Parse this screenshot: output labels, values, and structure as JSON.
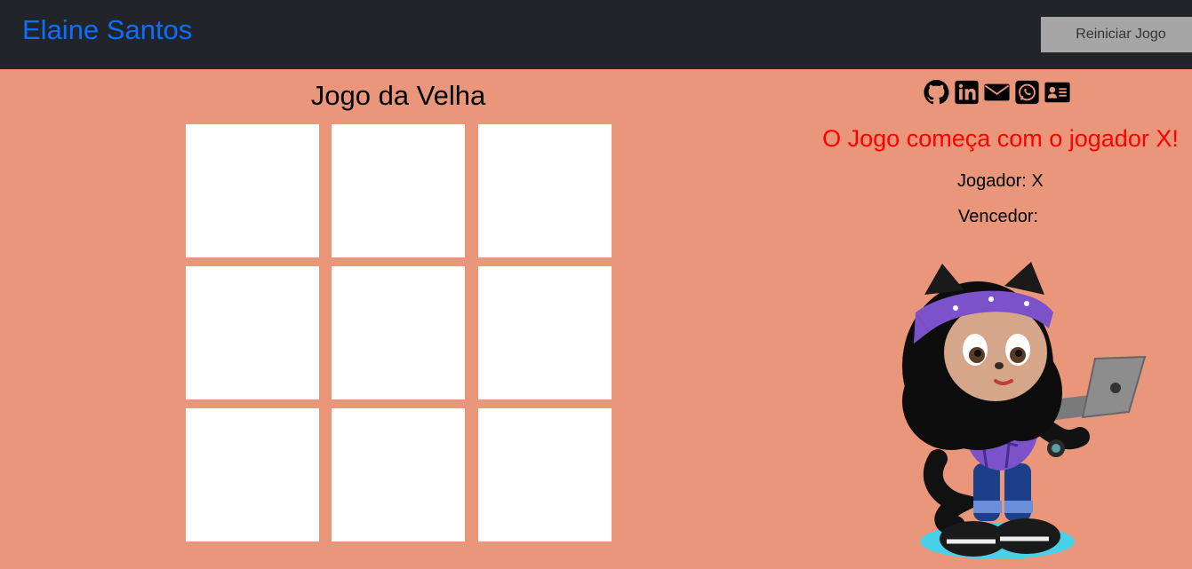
{
  "header": {
    "brand": "Elaine Santos",
    "restart_label": "Reiniciar Jogo"
  },
  "board": {
    "title": "Jogo da Velha",
    "cells": [
      "",
      "",
      "",
      "",
      "",
      "",
      "",
      "",
      ""
    ]
  },
  "social": {
    "icons": [
      "github-icon",
      "linkedin-icon",
      "envelope-icon",
      "whatsapp-icon",
      "contact-card-icon"
    ]
  },
  "status": {
    "start_message": "O Jogo começa com o jogador X!",
    "player_label": "Jogador: X",
    "winner_label": "Vencedor:"
  },
  "colors": {
    "background": "#e9967a",
    "navbar": "#212529",
    "brand": "#0d6efd",
    "message": "#ff0000",
    "button": "#a6a6a6"
  }
}
